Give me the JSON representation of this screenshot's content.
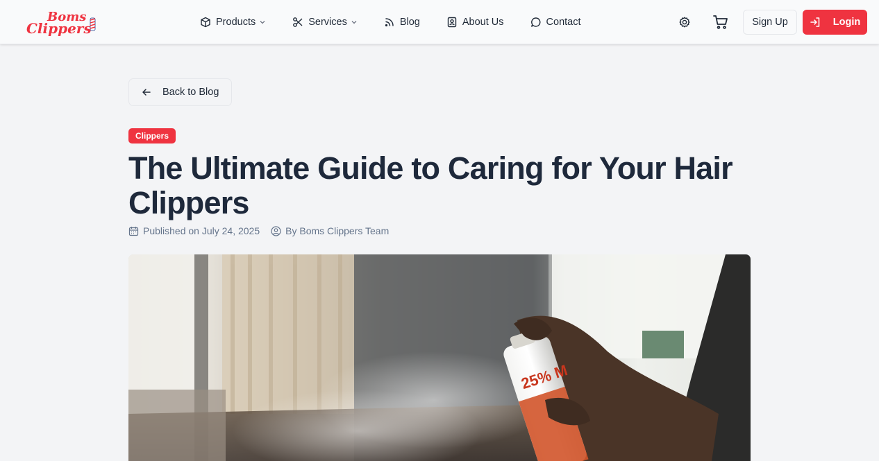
{
  "header": {
    "logo": {
      "line1": "Boms",
      "line2": "Clippers"
    },
    "nav": [
      {
        "label": "Products",
        "icon": "box-icon",
        "dropdown": true
      },
      {
        "label": "Services",
        "icon": "scissors-icon",
        "dropdown": true
      },
      {
        "label": "Blog",
        "icon": "rss-icon",
        "dropdown": false
      },
      {
        "label": "About Us",
        "icon": "contact-card-icon",
        "dropdown": false
      },
      {
        "label": "Contact",
        "icon": "chat-bubble-icon",
        "dropdown": false
      }
    ],
    "signup_label": "Sign Up",
    "login_label": "Login"
  },
  "article": {
    "back_label": "Back to Blog",
    "category": "Clippers",
    "title": "The Ultimate Guide to Caring for Your Hair Clippers",
    "published": "Published on July 24, 2025",
    "author": "By Boms Clippers Team"
  },
  "hero_image": {
    "can_text": "25% M"
  },
  "colors": {
    "accent": "#ef3340",
    "title": "#1e293b",
    "muted": "#64748b",
    "page_bg": "#f3f4f6"
  }
}
